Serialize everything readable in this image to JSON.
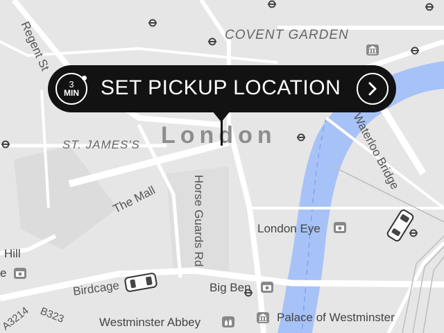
{
  "pickup": {
    "eta_value": "3",
    "eta_unit": "MIN",
    "label": "SET PICKUP LOCATION",
    "go_icon": "chevron-right-icon"
  },
  "map": {
    "city": "London",
    "labels": {
      "regent_st": "Regent St",
      "covent_garden": "COVENT GARDEN",
      "st_james": "ST. JAMES'S",
      "the_mall": "The Mall",
      "horse_guards": "Horse Guards Rd",
      "waterloo_bridge": "Waterloo Bridge",
      "london_eye": "London Eye",
      "big_ben": "Big Ben",
      "westminster_abbey": "Westminster Abbey",
      "palace": "Palace of Westminster",
      "birdcage": "Birdcage",
      "a3214": "A3214",
      "b323": "B323",
      "hill": "Hill",
      "e_fragment": "e"
    }
  },
  "colors": {
    "map_bg": "#e6e6e6",
    "road": "#ffffff",
    "river": "#a7c2f7",
    "pill": "#121212",
    "label_text": "#555555"
  },
  "icons": [
    "tube-icon",
    "museum-icon",
    "camera-icon",
    "car-icon",
    "chevron-right-icon"
  ]
}
